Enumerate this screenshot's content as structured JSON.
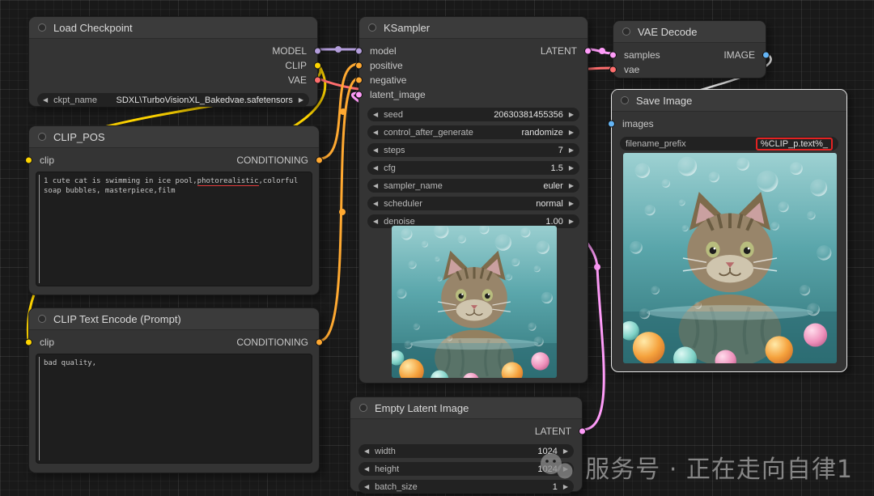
{
  "icons": {
    "arrow_left": "◀",
    "arrow_right": "▶"
  },
  "colors": {
    "model": "#B39DDB",
    "clip": "#FFD500",
    "vae": "#FF6E6E",
    "conditioning": "#FFA931",
    "latent": "#FF9CF9",
    "image": "#64B5F6",
    "link_white": "#E8E8E8",
    "highlight_red": "#E32222"
  },
  "nodes": {
    "load_checkpoint": {
      "title": "Load Checkpoint",
      "outputs": [
        "MODEL",
        "CLIP",
        "VAE"
      ],
      "widgets": [
        {
          "label": "ckpt_name",
          "value": "SDXL\\TurboVisionXL_Bakedvae.safetensors"
        }
      ]
    },
    "clip_pos": {
      "title": "CLIP_POS",
      "input": "clip",
      "output": "CONDITIONING",
      "prompt": {
        "part1": "1 cute cat is swimming in ice pool,",
        "part2": "photorealistic",
        "part3": ",colorful soap bubbles, masterpiece,film"
      }
    },
    "clip_neg": {
      "title": "CLIP Text Encode (Prompt)",
      "input": "clip",
      "output": "CONDITIONING",
      "prompt": "bad quality,"
    },
    "ksampler": {
      "title": "KSampler",
      "inputs": [
        "model",
        "positive",
        "negative",
        "latent_image"
      ],
      "output": "LATENT",
      "widgets": [
        {
          "label": "seed",
          "value": "20630381455356"
        },
        {
          "label": "control_after_generate",
          "value": "randomize"
        },
        {
          "label": "steps",
          "value": "7"
        },
        {
          "label": "cfg",
          "value": "1.5"
        },
        {
          "label": "sampler_name",
          "value": "euler"
        },
        {
          "label": "scheduler",
          "value": "normal"
        },
        {
          "label": "denoise",
          "value": "1.00"
        }
      ]
    },
    "vae_decode": {
      "title": "VAE Decode",
      "inputs": [
        "samples",
        "vae"
      ],
      "output": "IMAGE"
    },
    "save_image": {
      "title": "Save Image",
      "input": "images",
      "widgets": [
        {
          "label": "filename_prefix",
          "value": "%CLIP_p.text%_"
        }
      ]
    },
    "empty_latent": {
      "title": "Empty Latent Image",
      "output": "LATENT",
      "widgets": [
        {
          "label": "width",
          "value": "1024"
        },
        {
          "label": "height",
          "value": "1024"
        },
        {
          "label": "batch_size",
          "value": "1"
        }
      ]
    }
  },
  "watermark": {
    "text": "服务号 · 正在走向自律1"
  }
}
